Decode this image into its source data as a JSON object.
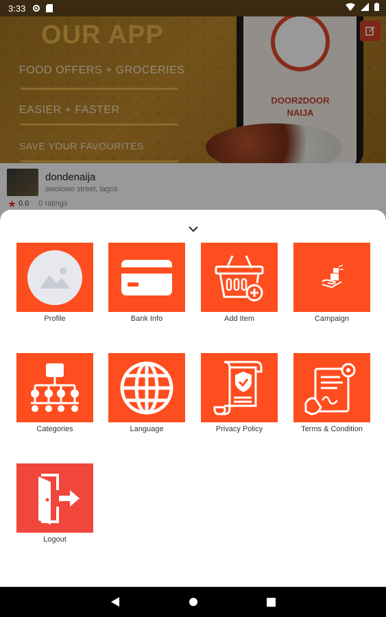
{
  "status_bar": {
    "time": "3:33"
  },
  "banner": {
    "title": "OUR APP",
    "line1": "FOOD OFFERS + GROCERIES",
    "line2": "EASIER + FASTER",
    "line3": "SAVE YOUR FAVOURITES",
    "phone_text_1": "DOOR2DOOR",
    "phone_text_2": "NAIJA"
  },
  "store": {
    "name": "dondenaija",
    "address": "awolowo street, lagos",
    "rating": "0.0",
    "ratings_count": "0 ratings"
  },
  "menu": {
    "items": [
      {
        "label": "Profile",
        "icon": "profile-image-icon"
      },
      {
        "label": "Bank Info",
        "icon": "credit-card-icon"
      },
      {
        "label": "Add Item",
        "icon": "basket-add-icon"
      },
      {
        "label": "Campaign",
        "icon": "campaign-icon"
      },
      {
        "label": "Categories",
        "icon": "hierarchy-icon"
      },
      {
        "label": "Language",
        "icon": "globe-icon"
      },
      {
        "label": "Privacy Policy",
        "icon": "shield-document-icon"
      },
      {
        "label": "Terms & Condition",
        "icon": "contract-icon"
      },
      {
        "label": "Logout",
        "icon": "exit-door-icon"
      }
    ]
  },
  "colors": {
    "accent": "#fe4d1e",
    "logout": "#f0463c",
    "banner": "#b07c26"
  }
}
